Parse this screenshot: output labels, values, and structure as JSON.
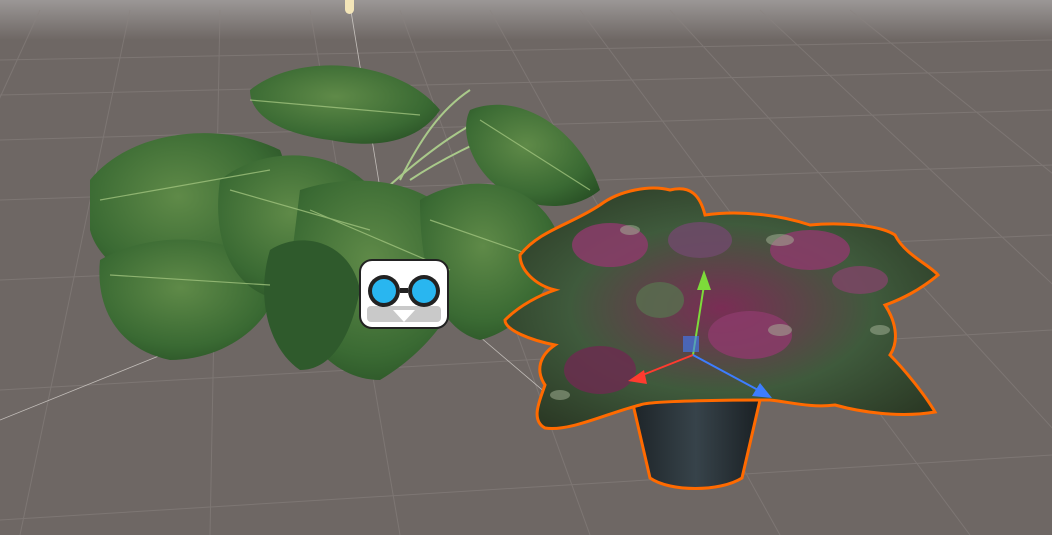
{
  "scene": {
    "view": "Scene",
    "colors": {
      "background": "#6e6764",
      "horizon": "#8b8684",
      "grid": "#8a8380",
      "selection_outline": "#ff6a00",
      "axis_x": "#ff3b2f",
      "axis_y": "#7ddb3a",
      "axis_z": "#3d7dff",
      "camera_lens": "#29b6f0"
    },
    "objects": [
      {
        "name": "monstera-plant",
        "selected": false
      },
      {
        "name": "begonia-plant",
        "selected": true
      }
    ],
    "gizmos": [
      "vr-camera-gizmo",
      "move-tool-gizmo",
      "light-gizmo"
    ]
  }
}
